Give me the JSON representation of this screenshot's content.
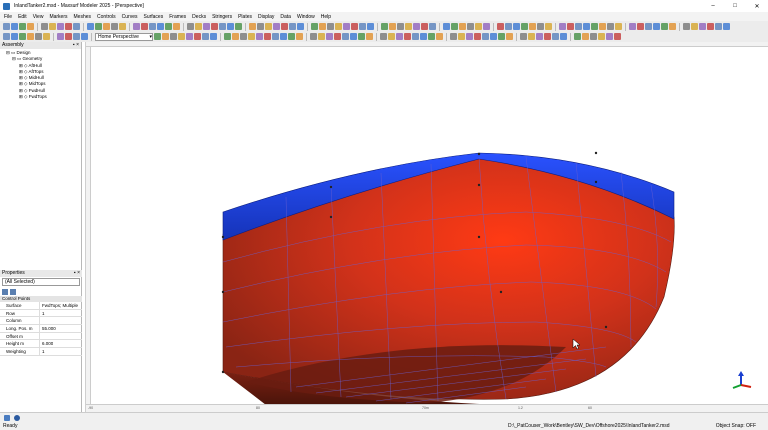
{
  "window": {
    "title": "InlandTanker2.msd - Maxsurf Modeler 2025 - [Perspective]",
    "minimize_glyph": "–",
    "maximize_glyph": "□",
    "close_glyph": "✕"
  },
  "menu": [
    "File",
    "Edit",
    "View",
    "Markers",
    "Meshes",
    "Controls",
    "Curves",
    "Surfaces",
    "Frames",
    "Decks",
    "Stringers",
    "Plates",
    "Display",
    "Data",
    "Window",
    "Help"
  ],
  "toolbar": {
    "view_select": "Home Perspective"
  },
  "assembly": {
    "title": "Assembly",
    "items": [
      {
        "label": "Design",
        "level": 1
      },
      {
        "label": "Geometry",
        "level": 2
      },
      {
        "label": "AftHull",
        "level": 3
      },
      {
        "label": "AftTops",
        "level": 3
      },
      {
        "label": "MidHull",
        "level": 3
      },
      {
        "label": "MidTops",
        "level": 3
      },
      {
        "label": "FwdHull",
        "level": 3
      },
      {
        "label": "FwdTops",
        "level": 3
      }
    ]
  },
  "properties": {
    "title": "Properties",
    "selector": "(All Selected)",
    "group": "Control Points",
    "rows": [
      {
        "key": "Surface",
        "value": "FwdTops; Multiple"
      },
      {
        "key": "Row",
        "value": "1"
      },
      {
        "key": "Column",
        "value": ""
      },
      {
        "key": "Long. Pos. m",
        "value": "55.000"
      },
      {
        "key": "Offset m",
        "value": ""
      },
      {
        "key": "Height m",
        "value": "6.000"
      },
      {
        "key": "Weighting",
        "value": "1"
      }
    ]
  },
  "ruler": {
    "bottom_ticks": [
      "-90",
      "80",
      "70m",
      "1.2",
      "60"
    ]
  },
  "status": {
    "left": "Ready",
    "path": "D:\\_PatCouser_Work\\Bentley\\SW_Dev\\Offshore2025\\InlandTanker2.msd",
    "snap": "Object Snap: OFF"
  },
  "colors": {
    "hull": "#c8311a",
    "topside": "#1f3fd4",
    "gridline": "#6a5fd0"
  }
}
